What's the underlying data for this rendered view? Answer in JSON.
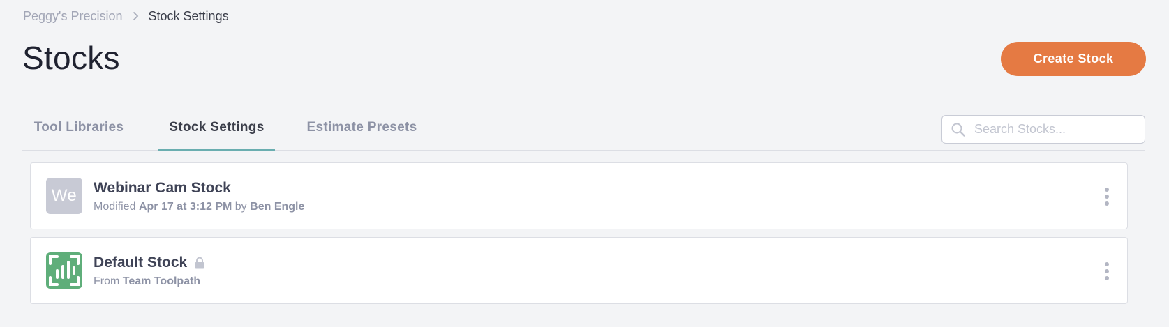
{
  "breadcrumb": {
    "items": [
      "Peggy's Precision",
      "Stock Settings"
    ],
    "separator_icon": "chevron-right-icon"
  },
  "page": {
    "title": "Stocks",
    "create_button_label": "Create Stock"
  },
  "tabs": [
    {
      "label": "Tool Libraries",
      "active": false
    },
    {
      "label": "Stock Settings",
      "active": true
    },
    {
      "label": "Estimate Presets",
      "active": false
    }
  ],
  "search": {
    "placeholder": "Search Stocks...",
    "value": "",
    "icon": "search-icon"
  },
  "stocks": [
    {
      "name": "Webinar Cam Stock",
      "avatar_initials": "We",
      "meta_prefix": "Modified",
      "meta_time": "Apr 17 at 3:12 PM",
      "meta_by": "by",
      "meta_user": "Ben Engle",
      "locked": false
    },
    {
      "name": "Default Stock",
      "avatar_icon": "toolpath-logo-icon",
      "meta_prefix": "From",
      "meta_source": "Team Toolpath",
      "locked": true
    }
  ],
  "colors": {
    "accent": "#e57a43",
    "tab_indicator": "#6aaeb0",
    "logo_green": "#5fae7a",
    "background": "#f3f4f6"
  }
}
